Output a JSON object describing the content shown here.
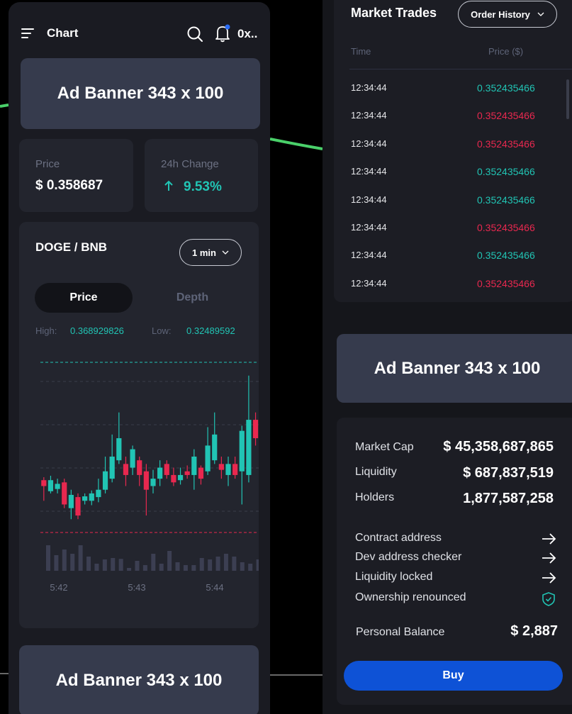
{
  "header": {
    "title": "Chart",
    "wallet_label": "0x.."
  },
  "ads": {
    "top_label": "Ad Banner 343 x 100",
    "bottom_label": "Ad Banner 343 x 100",
    "right_label": "Ad Banner 343 x 100"
  },
  "stats": {
    "price_label": "Price",
    "price_value": "$ 0.358687",
    "change_label": "24h Change",
    "change_value": "9.53%"
  },
  "chart_panel": {
    "pair": "DOGE / BNB",
    "interval": "1 min",
    "tabs": [
      "Price",
      "Depth"
    ],
    "high_label": "High:",
    "high_value": "0.368929826",
    "low_label": "Low:",
    "low_value": "0.32489592"
  },
  "chart_data": {
    "type": "candlestick",
    "x_tick_labels": [
      "5:42",
      "5:43",
      "5:44"
    ],
    "reference_lines": {
      "high": 0.368929826,
      "low": 0.32489592
    },
    "candles": [
      {
        "o": 0.337,
        "c": 0.3378,
        "h": 0.3382,
        "l": 0.335,
        "up": false
      },
      {
        "o": 0.3363,
        "c": 0.3378,
        "h": 0.3384,
        "l": 0.336,
        "up": true
      },
      {
        "o": 0.3366,
        "c": 0.3373,
        "h": 0.338,
        "l": 0.336,
        "up": true
      },
      {
        "o": 0.3375,
        "c": 0.3345,
        "h": 0.338,
        "l": 0.334,
        "up": false
      },
      {
        "o": 0.334,
        "c": 0.3358,
        "h": 0.3365,
        "l": 0.3325,
        "up": true
      },
      {
        "o": 0.3355,
        "c": 0.333,
        "h": 0.336,
        "l": 0.3325,
        "up": false
      },
      {
        "o": 0.335,
        "c": 0.3356,
        "h": 0.336,
        "l": 0.3345,
        "up": true
      },
      {
        "o": 0.335,
        "c": 0.336,
        "h": 0.3364,
        "l": 0.3344,
        "up": true
      },
      {
        "o": 0.3355,
        "c": 0.3365,
        "h": 0.338,
        "l": 0.3348,
        "up": true
      },
      {
        "o": 0.3365,
        "c": 0.339,
        "h": 0.341,
        "l": 0.336,
        "up": true
      },
      {
        "o": 0.338,
        "c": 0.341,
        "h": 0.344,
        "l": 0.3375,
        "up": true
      },
      {
        "o": 0.3405,
        "c": 0.3435,
        "h": 0.347,
        "l": 0.34,
        "up": true
      },
      {
        "o": 0.34,
        "c": 0.3385,
        "h": 0.341,
        "l": 0.337,
        "up": false
      },
      {
        "o": 0.3395,
        "c": 0.342,
        "h": 0.3425,
        "l": 0.3385,
        "up": true
      },
      {
        "o": 0.3405,
        "c": 0.3385,
        "h": 0.341,
        "l": 0.337,
        "up": false
      },
      {
        "o": 0.339,
        "c": 0.3365,
        "h": 0.34,
        "l": 0.333,
        "up": false
      },
      {
        "o": 0.337,
        "c": 0.338,
        "h": 0.3392,
        "l": 0.336,
        "up": true
      },
      {
        "o": 0.338,
        "c": 0.3395,
        "h": 0.3405,
        "l": 0.337,
        "up": true
      },
      {
        "o": 0.34,
        "c": 0.3385,
        "h": 0.3405,
        "l": 0.338,
        "up": false
      },
      {
        "o": 0.3385,
        "c": 0.3375,
        "h": 0.3395,
        "l": 0.337,
        "up": false
      },
      {
        "o": 0.3378,
        "c": 0.3385,
        "h": 0.3395,
        "l": 0.3372,
        "up": true
      },
      {
        "o": 0.339,
        "c": 0.3385,
        "h": 0.3398,
        "l": 0.338,
        "up": false
      },
      {
        "o": 0.3385,
        "c": 0.341,
        "h": 0.342,
        "l": 0.3365,
        "up": true
      },
      {
        "o": 0.3395,
        "c": 0.338,
        "h": 0.3398,
        "l": 0.3372,
        "up": false
      },
      {
        "o": 0.339,
        "c": 0.3425,
        "h": 0.345,
        "l": 0.3385,
        "up": true
      },
      {
        "o": 0.3405,
        "c": 0.344,
        "h": 0.347,
        "l": 0.34,
        "up": true
      },
      {
        "o": 0.34,
        "c": 0.3392,
        "h": 0.341,
        "l": 0.338,
        "up": false
      },
      {
        "o": 0.3385,
        "c": 0.34,
        "h": 0.341,
        "l": 0.337,
        "up": true
      },
      {
        "o": 0.34,
        "c": 0.3385,
        "h": 0.341,
        "l": 0.338,
        "up": false
      },
      {
        "o": 0.339,
        "c": 0.3445,
        "h": 0.3452,
        "l": 0.3345,
        "up": true
      },
      {
        "o": 0.3385,
        "c": 0.346,
        "h": 0.352,
        "l": 0.3375,
        "up": true
      },
      {
        "o": 0.346,
        "c": 0.3435,
        "h": 0.347,
        "l": 0.3425,
        "up": false
      },
      {
        "o": 0.3445,
        "c": 0.343,
        "h": 0.345,
        "l": 0.3425,
        "up": false
      }
    ],
    "volume": [
      0.9,
      0.55,
      0.75,
      0.6,
      0.9,
      0.5,
      0.25,
      0.4,
      0.45,
      0.42,
      0.1,
      0.35,
      0.2,
      0.6,
      0.25,
      0.7,
      0.3,
      0.2,
      0.2,
      0.45,
      0.4,
      0.5,
      0.6,
      0.5,
      0.3,
      0.25,
      0.4
    ]
  },
  "market_trades": {
    "title": "Market Trades",
    "order_history_label": "Order History",
    "col_time": "Time",
    "col_price": "Price ($)",
    "rows": [
      {
        "time": "12:34:44",
        "price": "0.352435466",
        "side": "buy"
      },
      {
        "time": "12:34:44",
        "price": "0.352435466",
        "side": "sell"
      },
      {
        "time": "12:34:44",
        "price": "0.352435466",
        "side": "sell"
      },
      {
        "time": "12:34:44",
        "price": "0.352435466",
        "side": "buy"
      },
      {
        "time": "12:34:44",
        "price": "0.352435466",
        "side": "buy"
      },
      {
        "time": "12:34:44",
        "price": "0.352435466",
        "side": "sell"
      },
      {
        "time": "12:34:44",
        "price": "0.352435466",
        "side": "buy"
      },
      {
        "time": "12:34:44",
        "price": "0.352435466",
        "side": "sell"
      }
    ]
  },
  "token_info": {
    "market_cap_label": "Market Cap",
    "market_cap_value": "$ 45,358,687,865",
    "liquidity_label": "Liquidity",
    "liquidity_value": "$ 687,837,519",
    "holders_label": "Holders",
    "holders_value": "1,877,587,258",
    "links": [
      "Contract address",
      "Dev address checker",
      "Liquidity locked",
      "Ownership renounced"
    ],
    "balance_label": "Personal Balance",
    "balance_value": "$ 2,887",
    "buy_label": "Buy"
  },
  "colors": {
    "up": "#21c4b4",
    "down": "#e8284f",
    "accent_blue": "#0e52d6",
    "bell_dot": "#2a6cf5"
  }
}
